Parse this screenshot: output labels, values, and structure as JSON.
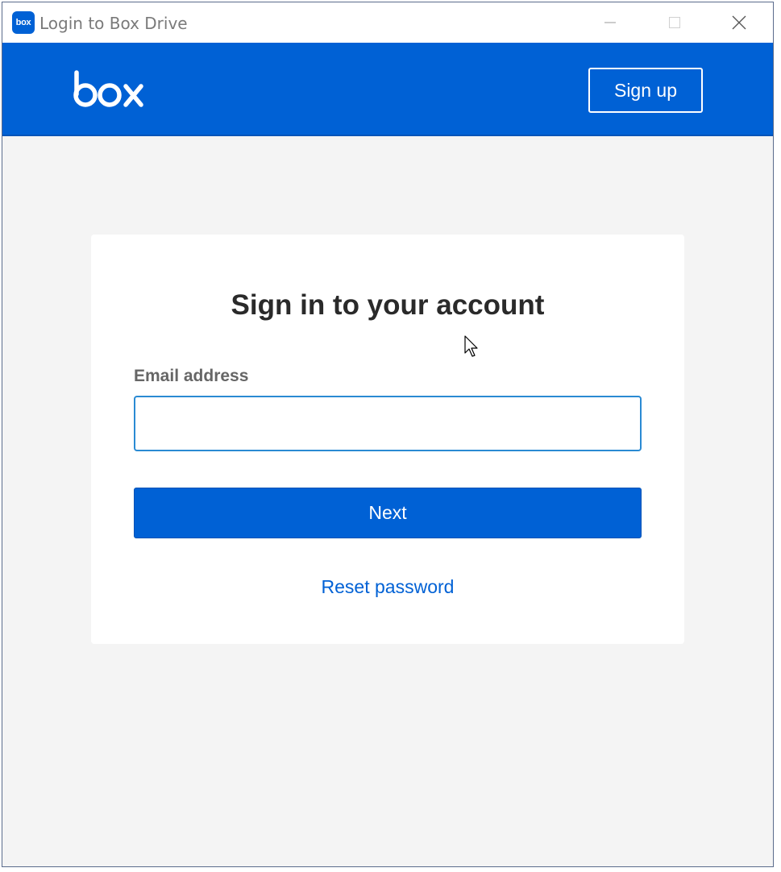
{
  "window": {
    "title": "Login to Box Drive",
    "app_icon_text": "box",
    "controls": [
      "minimize-icon",
      "maximize-icon",
      "close-icon"
    ]
  },
  "header": {
    "logo_text": "box",
    "signup_label": "Sign up",
    "background_color": "#0061d5"
  },
  "login_card": {
    "title": "Sign in to your account",
    "email_label": "Email address",
    "email_value": "",
    "email_placeholder": "",
    "next_label": "Next",
    "reset_password_label": "Reset password"
  },
  "colors": {
    "brand_blue": "#0061d5",
    "page_background": "#f4f4f4",
    "input_focus_border": "#2a8ad3"
  }
}
